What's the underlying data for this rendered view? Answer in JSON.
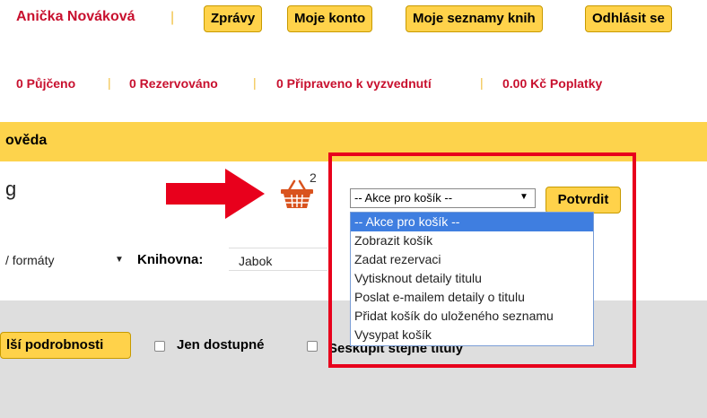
{
  "user": {
    "name": "Anička Nováková",
    "separator": "|"
  },
  "top_buttons": [
    "Zprávy",
    "Moje konto",
    "Moje seznamy knih",
    "Odhlásit se"
  ],
  "status": {
    "borrowed": "0 Půjčeno",
    "reserved": "0 Rezervováno",
    "ready": "0 Připraveno k vyzvednutí",
    "fees": "0.00 Kč Poplatky",
    "separator": "|"
  },
  "menu": {
    "help": "ověda"
  },
  "search": {
    "partial_title": "g"
  },
  "cart": {
    "count": "2",
    "select_label": "-- Akce pro košík --",
    "confirm": "Potvrdit",
    "options": [
      "-- Akce pro košík --",
      "Zobrazit košík",
      "Zadat rezervaci",
      "Vytisknout detaily titulu",
      "Poslat e-mailem detaily o titulu",
      "Přidat košík do uloženého seznamu",
      "Vysypat košík"
    ],
    "selected_index": 0
  },
  "filters": {
    "formats": "/ formáty",
    "library_label": "Knihovna:",
    "library_value": "Jabok"
  },
  "results": {
    "more_details": "lší podrobnosti",
    "only_available": "Jen dostupné",
    "group_titles": "Seskupit stejné tituly"
  },
  "colors": {
    "accent_yellow": "#ffd24a",
    "menu_yellow": "#fdd34c",
    "user_red": "#c8102e",
    "highlight_red": "#e8001c",
    "dropdown_selected": "#3f7ee0"
  },
  "icons": {
    "basket": "shopping-basket-icon",
    "arrow": "red-arrow-right-icon"
  }
}
